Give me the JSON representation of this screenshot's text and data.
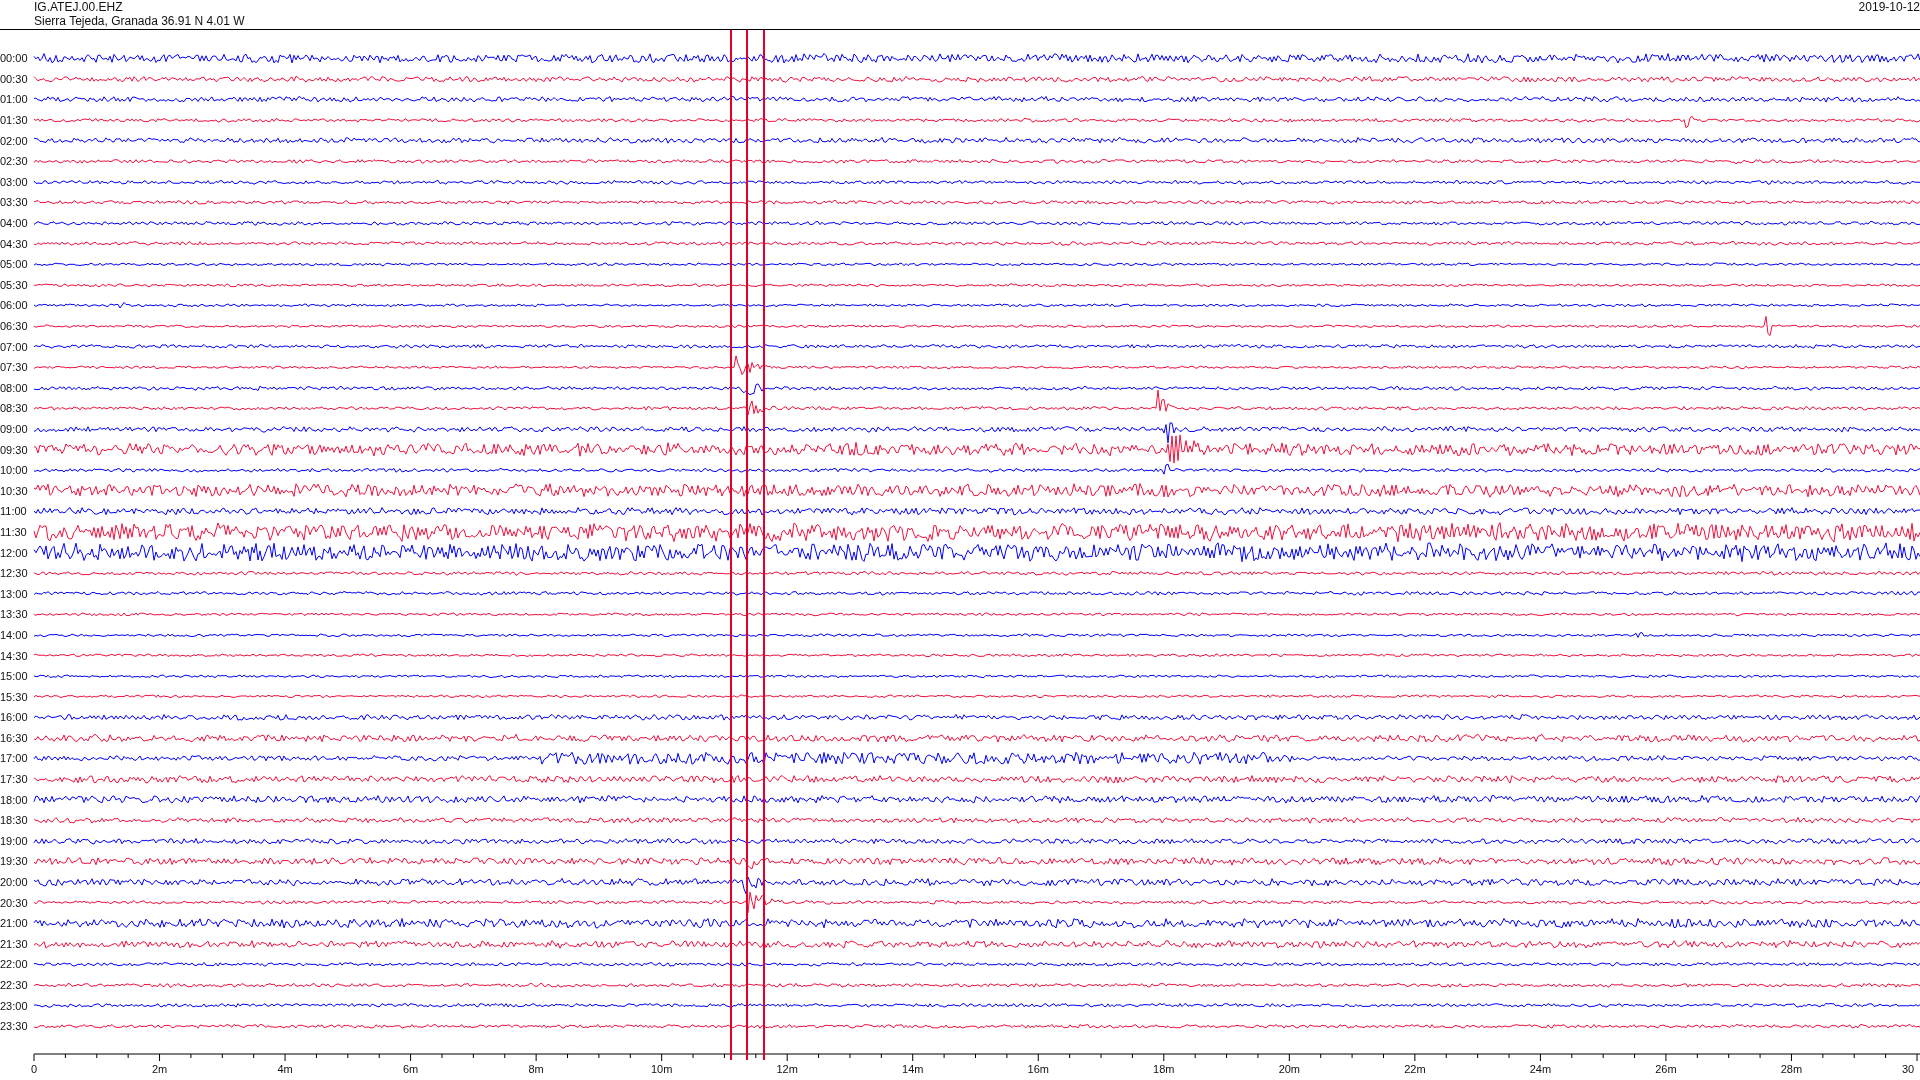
{
  "header": {
    "station": "IG.ATEJ.00.EHZ",
    "location": "Sierra Tejeda, Granada  36.91 N 4.01 W",
    "date": "2019-10-12"
  },
  "rows": [
    {
      "time": "00:00",
      "color": "#0000ff"
    },
    {
      "time": "00:30",
      "color": "#f0103c"
    },
    {
      "time": "01:00",
      "color": "#0000ff"
    },
    {
      "time": "01:30",
      "color": "#f0103c"
    },
    {
      "time": "02:00",
      "color": "#0000ff"
    },
    {
      "time": "02:30",
      "color": "#f0103c"
    },
    {
      "time": "03:00",
      "color": "#0000ff"
    },
    {
      "time": "03:30",
      "color": "#f0103c"
    },
    {
      "time": "04:00",
      "color": "#0000ff"
    },
    {
      "time": "04:30",
      "color": "#f0103c"
    },
    {
      "time": "05:00",
      "color": "#0000ff"
    },
    {
      "time": "05:30",
      "color": "#f0103c"
    },
    {
      "time": "06:00",
      "color": "#0000ff"
    },
    {
      "time": "06:30",
      "color": "#f0103c"
    },
    {
      "time": "07:00",
      "color": "#0000ff"
    },
    {
      "time": "07:30",
      "color": "#f0103c"
    },
    {
      "time": "08:00",
      "color": "#0000ff"
    },
    {
      "time": "08:30",
      "color": "#f0103c"
    },
    {
      "time": "09:00",
      "color": "#0000ff"
    },
    {
      "time": "09:30",
      "color": "#f0103c"
    },
    {
      "time": "10:00",
      "color": "#0000ff"
    },
    {
      "time": "10:30",
      "color": "#f0103c"
    },
    {
      "time": "11:00",
      "color": "#0000ff"
    },
    {
      "time": "11:30",
      "color": "#f0103c"
    },
    {
      "time": "12:00",
      "color": "#0000ff"
    },
    {
      "time": "12:30",
      "color": "#f0103c"
    },
    {
      "time": "13:00",
      "color": "#0000ff"
    },
    {
      "time": "13:30",
      "color": "#f0103c"
    },
    {
      "time": "14:00",
      "color": "#0000ff"
    },
    {
      "time": "14:30",
      "color": "#f0103c"
    },
    {
      "time": "15:00",
      "color": "#0000ff"
    },
    {
      "time": "15:30",
      "color": "#f0103c"
    },
    {
      "time": "16:00",
      "color": "#0000ff"
    },
    {
      "time": "16:30",
      "color": "#f0103c"
    },
    {
      "time": "17:00",
      "color": "#0000ff"
    },
    {
      "time": "17:30",
      "color": "#f0103c"
    },
    {
      "time": "18:00",
      "color": "#0000ff"
    },
    {
      "time": "18:30",
      "color": "#f0103c"
    },
    {
      "time": "19:00",
      "color": "#0000ff"
    },
    {
      "time": "19:30",
      "color": "#f0103c"
    },
    {
      "time": "20:00",
      "color": "#0000ff"
    },
    {
      "time": "20:30",
      "color": "#f0103c"
    },
    {
      "time": "21:00",
      "color": "#0000ff"
    },
    {
      "time": "21:30",
      "color": "#f0103c"
    },
    {
      "time": "22:00",
      "color": "#0000ff"
    },
    {
      "time": "22:30",
      "color": "#f0103c"
    },
    {
      "time": "23:00",
      "color": "#0000ff"
    },
    {
      "time": "23:30",
      "color": "#f0103c"
    }
  ],
  "x_axis_labels": [
    "0",
    "2m",
    "4m",
    "6m",
    "8m",
    "10m",
    "12m",
    "14m",
    "16m",
    "18m",
    "20m",
    "22m",
    "24m",
    "26m",
    "28m",
    "30"
  ]
}
